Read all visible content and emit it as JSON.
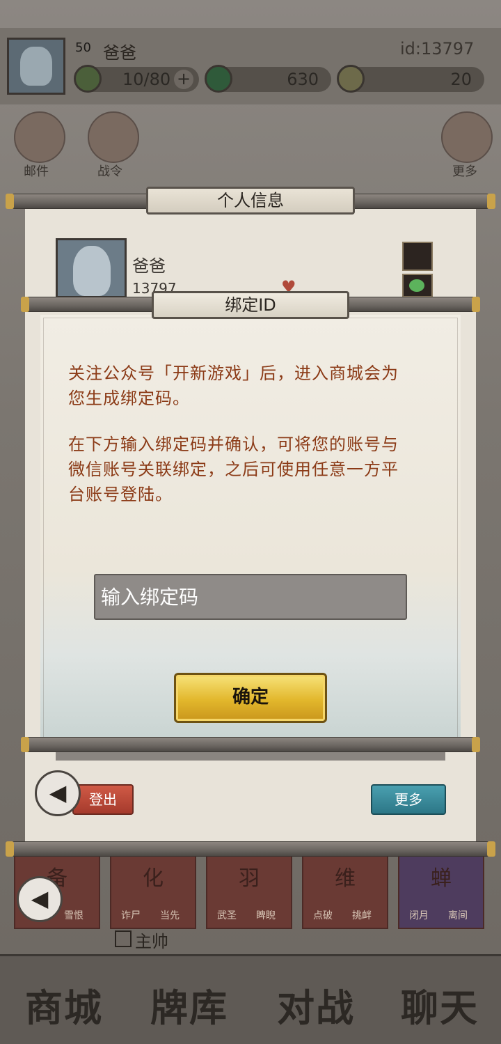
{
  "top": {
    "level": "50",
    "name": "爸爸",
    "id": "id:13797",
    "stamina": "10/80",
    "plus": "+",
    "jade": "630",
    "gems": "20"
  },
  "side": {
    "mail": "邮件",
    "battle_pass": "战令",
    "more": "更多"
  },
  "panel": {
    "title": "个人信息",
    "name": "爸爸",
    "id": "13797",
    "logout": "登出",
    "more": "更多"
  },
  "dialog": {
    "title": "绑定ID",
    "paragraph1_line1": "关注公众号「开新游戏」后，进入商城会为",
    "paragraph1_line2": "您生成绑定码。",
    "paragraph2_line1": "在下方输入绑定码并确认，可将您的账号与",
    "paragraph2_line2": "微信账号关联绑定，之后可使用任意一方平",
    "paragraph2_line3": "台账号登陆。",
    "input_placeholder": "输入绑定码",
    "confirm": "确定"
  },
  "cards": [
    {
      "title": "备",
      "s1": "雪恨",
      "s2": ""
    },
    {
      "title": "化",
      "s1": "诈尸",
      "s2": "当先"
    },
    {
      "title": "羽",
      "s1": "武圣",
      "s2": "睥睨"
    },
    {
      "title": "维",
      "s1": "点破",
      "s2": "挑衅"
    },
    {
      "title": "蝉",
      "s1": "闭月",
      "s2": "离间"
    }
  ],
  "main_commander": "主帅",
  "nav": {
    "shop": "商城",
    "deck": "牌库",
    "battle": "对战",
    "chat": "聊天"
  }
}
